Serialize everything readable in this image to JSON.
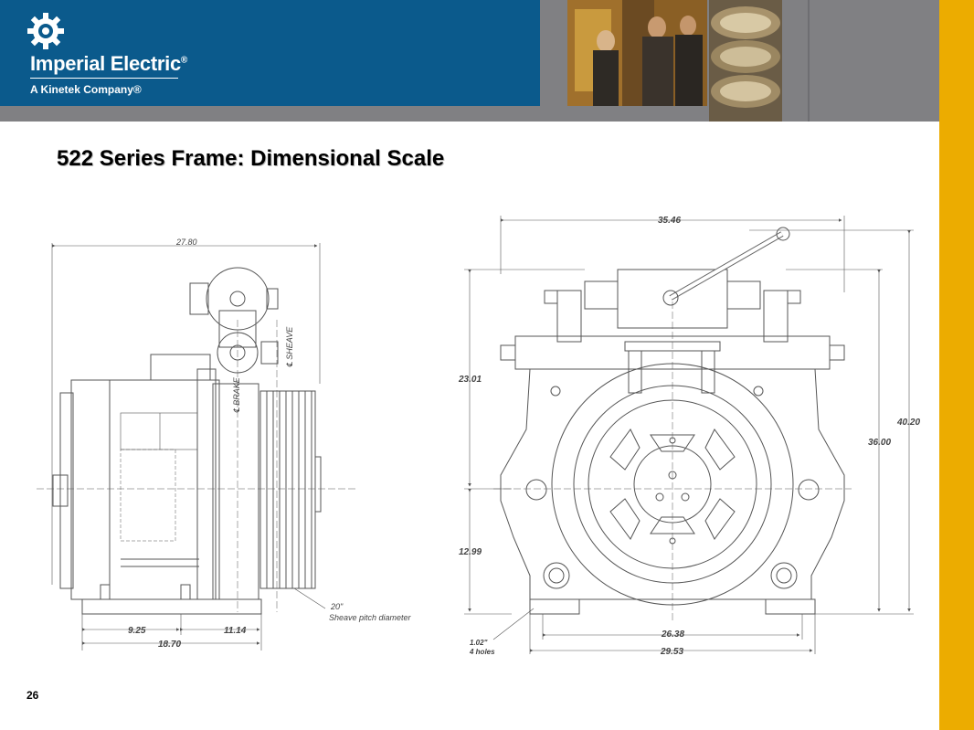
{
  "brand": {
    "name": "Imperial Electric",
    "registered": "®",
    "tagline": "A Kinetek Company®"
  },
  "slide": {
    "title": "522 Series Frame: Dimensional Scale",
    "page_number": "26"
  },
  "side_view": {
    "overall_width": "27.80",
    "dim_left_base": "9.25",
    "dim_right_base": "11.14",
    "dim_total_base": "18.70",
    "sheave_label": "℄ SHEAVE",
    "brake_label": "℄ BRAKE",
    "sheave_pitch_value": "20\"",
    "sheave_pitch_label": "Sheave pitch diameter"
  },
  "front_view": {
    "overall_width": "35.46",
    "upper_height": "23.01",
    "lower_height": "12.99",
    "total_height": "40.20",
    "body_height": "36.00",
    "hole_spacing": "26.38",
    "base_width": "29.53",
    "hole_size": "1.02\"",
    "hole_count": "4 holes"
  },
  "colors": {
    "brand_blue": "#0b5a8c",
    "accent_yellow": "#ecac00",
    "header_gray": "#808083"
  }
}
